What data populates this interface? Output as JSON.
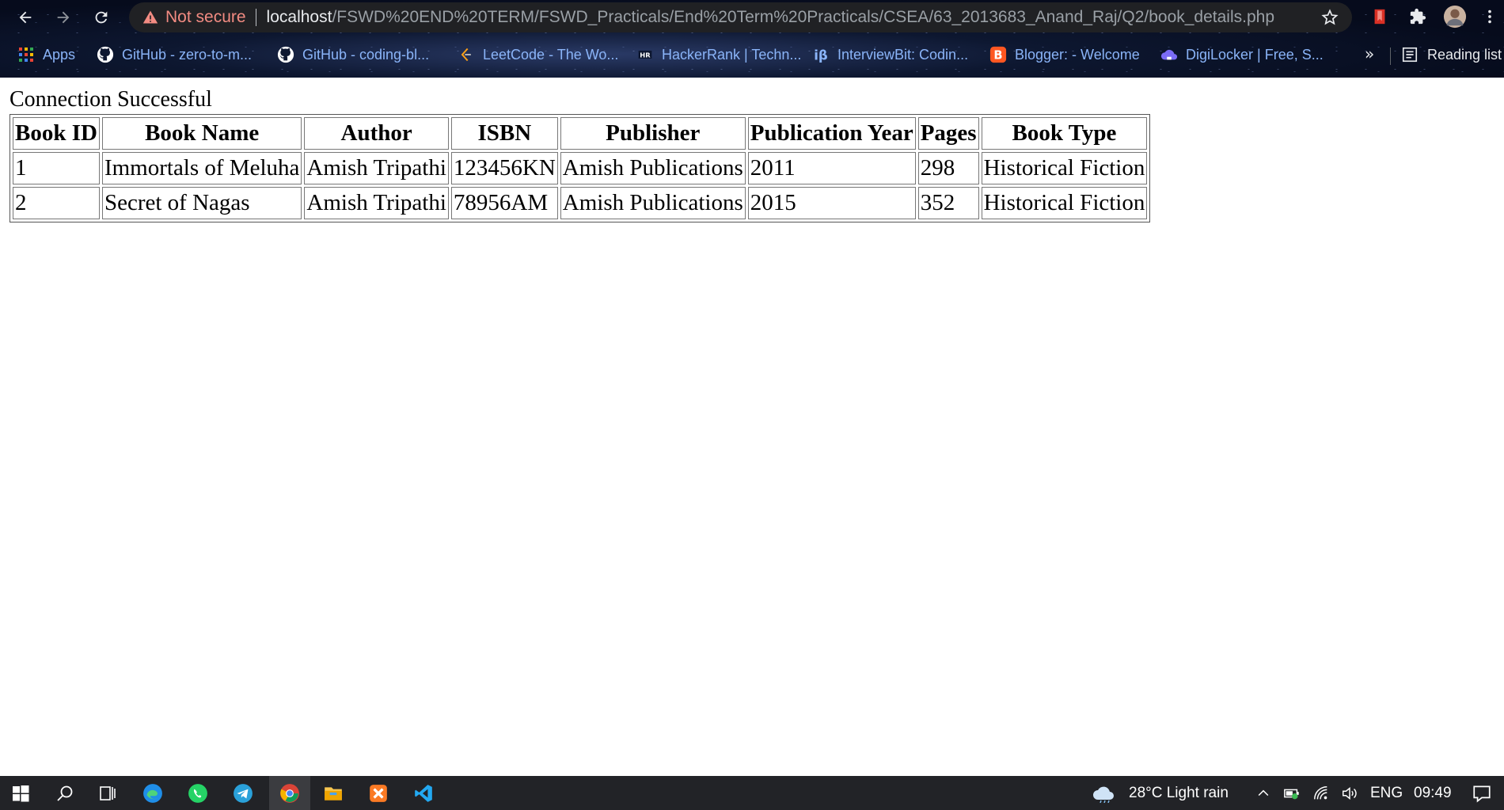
{
  "browser": {
    "security_label": "Not secure",
    "url_host": "localhost",
    "url_path": "/FSWD%20END%20TERM/FSWD_Practicals/End%20Term%20Practicals/CSEA/63_2013683_Anand_Raj/Q2/book_details.php",
    "bookmarks": [
      {
        "label": "Apps",
        "icon": "apps-grid-icon"
      },
      {
        "label": "GitHub - zero-to-m...",
        "icon": "github-icon"
      },
      {
        "label": "GitHub - coding-bl...",
        "icon": "github-icon"
      },
      {
        "label": "LeetCode - The Wo...",
        "icon": "leetcode-icon"
      },
      {
        "label": "HackerRank | Techn...",
        "icon": "hackerrank-icon"
      },
      {
        "label": "InterviewBit: Codin...",
        "icon": "interviewbit-icon"
      },
      {
        "label": "Blogger: - Welcome",
        "icon": "blogger-icon"
      },
      {
        "label": "DigiLocker | Free, S...",
        "icon": "digilocker-icon"
      }
    ],
    "more_bookmarks": "»",
    "reading_list": "Reading list"
  },
  "page": {
    "status_text": "Connection Successful",
    "table": {
      "headers": [
        "Book ID",
        "Book Name",
        "Author",
        "ISBN",
        "Publisher",
        "Publication Year",
        "Pages",
        "Book Type"
      ],
      "rows": [
        [
          "1",
          "Immortals of Meluha",
          "Amish Tripathi",
          "123456KN",
          "Amish Publications",
          "2011",
          "298",
          "Historical Fiction"
        ],
        [
          "2",
          "Secret of Nagas",
          "Amish Tripathi",
          "78956AM",
          "Amish Publications",
          "2015",
          "352",
          "Historical Fiction"
        ]
      ]
    }
  },
  "taskbar": {
    "weather": "28°C  Light rain",
    "language": "ENG",
    "time": "09:49"
  },
  "colors": {
    "security_warning": "#f28b82",
    "link": "#8ab4f8",
    "taskbar_bg": "#222327"
  }
}
